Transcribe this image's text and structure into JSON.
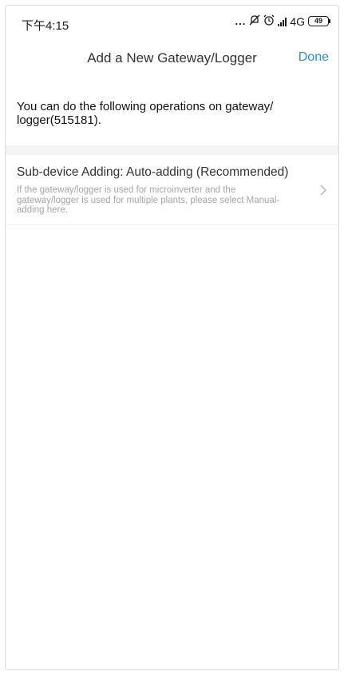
{
  "status_bar": {
    "time": "下午4:15",
    "dots": "...",
    "network": "4G",
    "battery": "49"
  },
  "nav": {
    "title": "Add a New Gateway/Logger",
    "done_label": "Done"
  },
  "intro_text": "You can do the following operations on gateway/ logger(515181).",
  "options": [
    {
      "title": "Sub-device Adding: Auto-adding (Recommended)",
      "description": "If the gateway/logger is used for microinverter and the gateway/logger is used for multiple plants, please select Manual-adding here."
    }
  ],
  "icons": {
    "status_mute": "mute-icon",
    "status_alarm": "alarm-icon",
    "chevron": "chevron-right-icon"
  },
  "colors": {
    "accent": "#2b8fd6",
    "secondary_text": "#a6a6a6",
    "band": "#f4f4f4"
  }
}
